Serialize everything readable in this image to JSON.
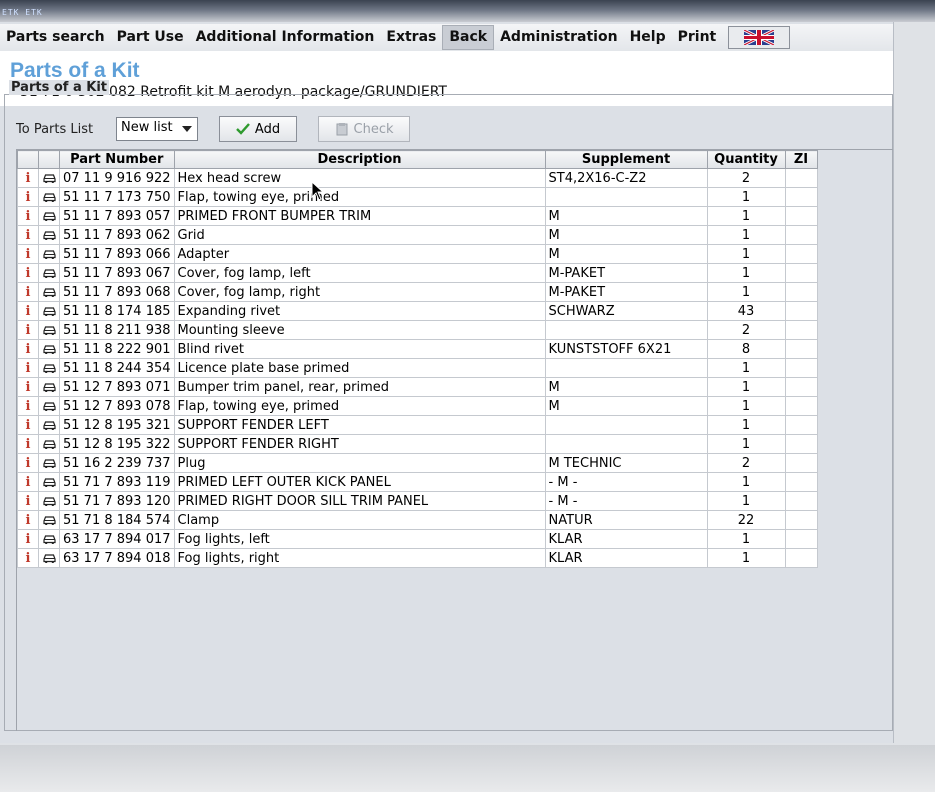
{
  "window": {
    "brand": "ETK ETK"
  },
  "menu": [
    {
      "label": "Parts search",
      "active": false
    },
    {
      "label": "Part Use",
      "active": false
    },
    {
      "label": "Additional Information",
      "active": false
    },
    {
      "label": "Extras",
      "active": false
    },
    {
      "label": "Back",
      "active": true
    },
    {
      "label": "Administration",
      "active": false
    },
    {
      "label": "Help",
      "active": false
    },
    {
      "label": "Print",
      "active": false
    }
  ],
  "flag_icon": "uk-flag-icon",
  "header": {
    "title": "Parts of a Kit",
    "subtitle": "51 71 0 302 082 Retrofit kit M aerodyn. package/GRUNDIERT"
  },
  "group": {
    "legend": "Parts of a Kit"
  },
  "toolbar": {
    "to_parts_list_label": "To Parts List",
    "list_select_value": "New list",
    "add_label": "Add",
    "check_label": "Check"
  },
  "table": {
    "columns": [
      "",
      "",
      "Part Number",
      "Description",
      "Supplement",
      "Quantity",
      "ZI"
    ],
    "rows": [
      {
        "part": "07 11 9 916 922",
        "desc": "Hex head screw",
        "supp": "ST4,2X16-C-Z2",
        "qty": "2",
        "zi": ""
      },
      {
        "part": "51 11 7 173 750",
        "desc": "Flap, towing eye, primed",
        "supp": "",
        "qty": "1",
        "zi": ""
      },
      {
        "part": "51 11 7 893 057",
        "desc": "PRIMED FRONT BUMPER TRIM",
        "supp": "M",
        "qty": "1",
        "zi": ""
      },
      {
        "part": "51 11 7 893 062",
        "desc": "Grid",
        "supp": "M",
        "qty": "1",
        "zi": ""
      },
      {
        "part": "51 11 7 893 066",
        "desc": "Adapter",
        "supp": "M",
        "qty": "1",
        "zi": ""
      },
      {
        "part": "51 11 7 893 067",
        "desc": "Cover, fog lamp, left",
        "supp": "M-PAKET",
        "qty": "1",
        "zi": ""
      },
      {
        "part": "51 11 7 893 068",
        "desc": "Cover, fog lamp, right",
        "supp": "M-PAKET",
        "qty": "1",
        "zi": ""
      },
      {
        "part": "51 11 8 174 185",
        "desc": "Expanding rivet",
        "supp": "SCHWARZ",
        "qty": "43",
        "zi": ""
      },
      {
        "part": "51 11 8 211 938",
        "desc": "Mounting sleeve",
        "supp": "",
        "qty": "2",
        "zi": ""
      },
      {
        "part": "51 11 8 222 901",
        "desc": "Blind rivet",
        "supp": "KUNSTSTOFF 6X21",
        "qty": "8",
        "zi": ""
      },
      {
        "part": "51 11 8 244 354",
        "desc": "Licence plate base primed",
        "supp": "",
        "qty": "1",
        "zi": ""
      },
      {
        "part": "51 12 7 893 071",
        "desc": "Bumper trim panel, rear, primed",
        "supp": "M",
        "qty": "1",
        "zi": ""
      },
      {
        "part": "51 12 7 893 078",
        "desc": "Flap, towing eye, primed",
        "supp": "M",
        "qty": "1",
        "zi": ""
      },
      {
        "part": "51 12 8 195 321",
        "desc": "SUPPORT FENDER LEFT",
        "supp": "",
        "qty": "1",
        "zi": ""
      },
      {
        "part": "51 12 8 195 322",
        "desc": "SUPPORT FENDER RIGHT",
        "supp": "",
        "qty": "1",
        "zi": ""
      },
      {
        "part": "51 16 2 239 737",
        "desc": "Plug",
        "supp": "M TECHNIC",
        "qty": "2",
        "zi": ""
      },
      {
        "part": "51 71 7 893 119",
        "desc": "PRIMED LEFT OUTER KICK PANEL",
        "supp": "- M -",
        "qty": "1",
        "zi": ""
      },
      {
        "part": "51 71 7 893 120",
        "desc": "PRIMED RIGHT DOOR SILL TRIM PANEL",
        "supp": "- M -",
        "qty": "1",
        "zi": ""
      },
      {
        "part": "51 71 8 184 574",
        "desc": "Clamp",
        "supp": "NATUR",
        "qty": "22",
        "zi": ""
      },
      {
        "part": "63 17 7 894 017",
        "desc": "Fog lights, left",
        "supp": "KLAR",
        "qty": "1",
        "zi": ""
      },
      {
        "part": "63 17 7 894 018",
        "desc": "Fog lights, right",
        "supp": "KLAR",
        "qty": "1",
        "zi": ""
      }
    ]
  },
  "colors": {
    "title": "#5fa0d8",
    "info_icon": "#c0392b",
    "check_mark": "#2e9a2e"
  }
}
